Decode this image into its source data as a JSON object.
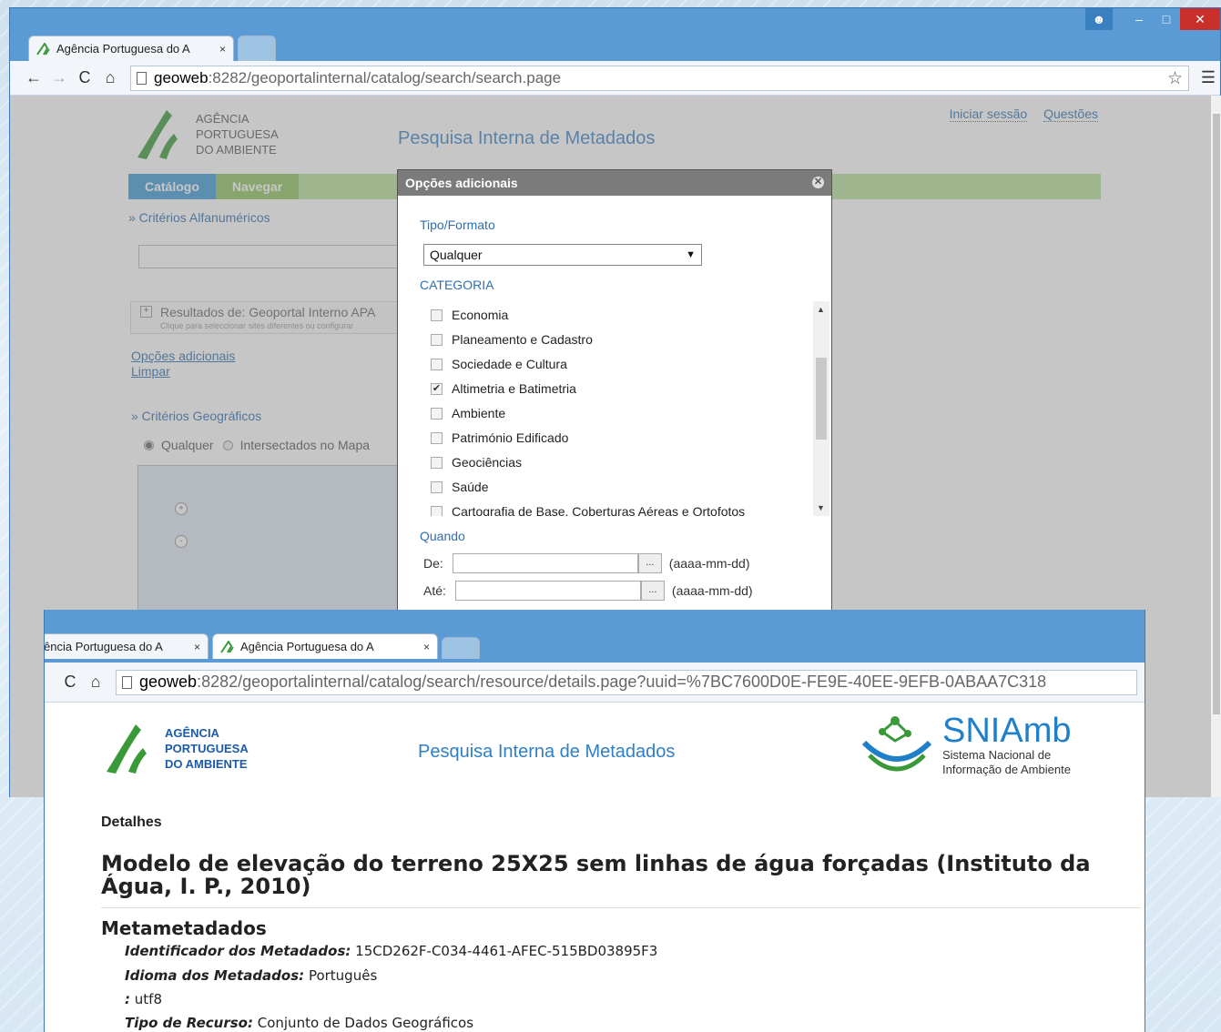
{
  "window1": {
    "tabs": [
      {
        "label": "Agência Portuguesa do A",
        "close": "×"
      }
    ],
    "url": {
      "host": "geoweb",
      "rest": ":8282/geoportalinternal/catalog/search/search.page"
    },
    "page": {
      "logo_lines": [
        "AGÊNCIA",
        "PORTUGUESA",
        "DO AMBIENTE"
      ],
      "title": "Pesquisa Interna de Metadados",
      "top_links": [
        "Iniciar sessão",
        "Questões"
      ],
      "nav": [
        "Catálogo",
        "Navegar"
      ],
      "criterios_alfa": "» Critérios Alfanuméricos",
      "results_title": "Resultados de: Geoportal Interno APA",
      "results_sub": "Clique para seleccionar sites diferentes ou configurar",
      "links": [
        "Opções adicionais",
        "Limpar"
      ],
      "criterios_geo": "» Critérios Geográficos",
      "radio_options": [
        "Qualquer",
        "Intersectados no Mapa"
      ]
    },
    "dialog": {
      "title": "Opções adicionais",
      "tipo_label": "Tipo/Formato",
      "tipo_value": "Qualquer",
      "categoria_label": "CATEGORIA",
      "categories": [
        {
          "label": "Economia",
          "checked": false
        },
        {
          "label": "Planeamento e Cadastro",
          "checked": false
        },
        {
          "label": "Sociedade e Cultura",
          "checked": false
        },
        {
          "label": "Altimetria e Batimetria",
          "checked": true
        },
        {
          "label": "Ambiente",
          "checked": false
        },
        {
          "label": "Património Edificado",
          "checked": false
        },
        {
          "label": "Geociências",
          "checked": false
        },
        {
          "label": "Saúde",
          "checked": false
        },
        {
          "label": "Cartografia de Base, Coberturas Aéreas e Ortofotos",
          "checked": false
        }
      ],
      "quando_label": "Quando",
      "de_label": "De:",
      "ate_label": "Até:",
      "date_hint": "(aaaa-mm-dd)",
      "date_button": "..."
    }
  },
  "window2": {
    "tabs": [
      {
        "label": "ência Portuguesa do A",
        "close": "×"
      },
      {
        "label": "Agência Portuguesa do A",
        "close": "×"
      }
    ],
    "url": {
      "host": "geoweb",
      "rest": ":8282/geoportalinternal/catalog/search/resource/details.page?uuid=%7BC7600D0E-FE9E-40EE-9EFB-0ABAA7C318"
    },
    "page": {
      "logo_lines": [
        "AGÊNCIA",
        "PORTUGUESA",
        "DO AMBIENTE"
      ],
      "title": "Pesquisa Interna de Metadados",
      "sni_big": "SNIAmb",
      "sni_small": [
        "Sistema Nacional de",
        "Informação de Ambiente"
      ],
      "detalhes": "Detalhes",
      "doc_title": "Modelo de elevação do terreno 25X25 sem linhas de água forçadas (Instituto da Água, I. P., 2010)",
      "metametadados": "Metametadados",
      "rows": [
        {
          "key": "Identificador dos Metadados:",
          "value": "15CD262F-C034-4461-AFEC-515BD03895F3"
        },
        {
          "key": "Idioma dos Metadados:",
          "value": "Português"
        },
        {
          "key": ":",
          "value": "utf8"
        },
        {
          "key": "Tipo de Recurso:",
          "value": "Conjunto de Dados Geográficos"
        }
      ]
    }
  },
  "colors": {
    "brand_blue": "#2e7fc7",
    "nav_green": "#b9e09a",
    "chrome_blue": "#5b9bd5",
    "logo_green": "#3a9a3a"
  }
}
